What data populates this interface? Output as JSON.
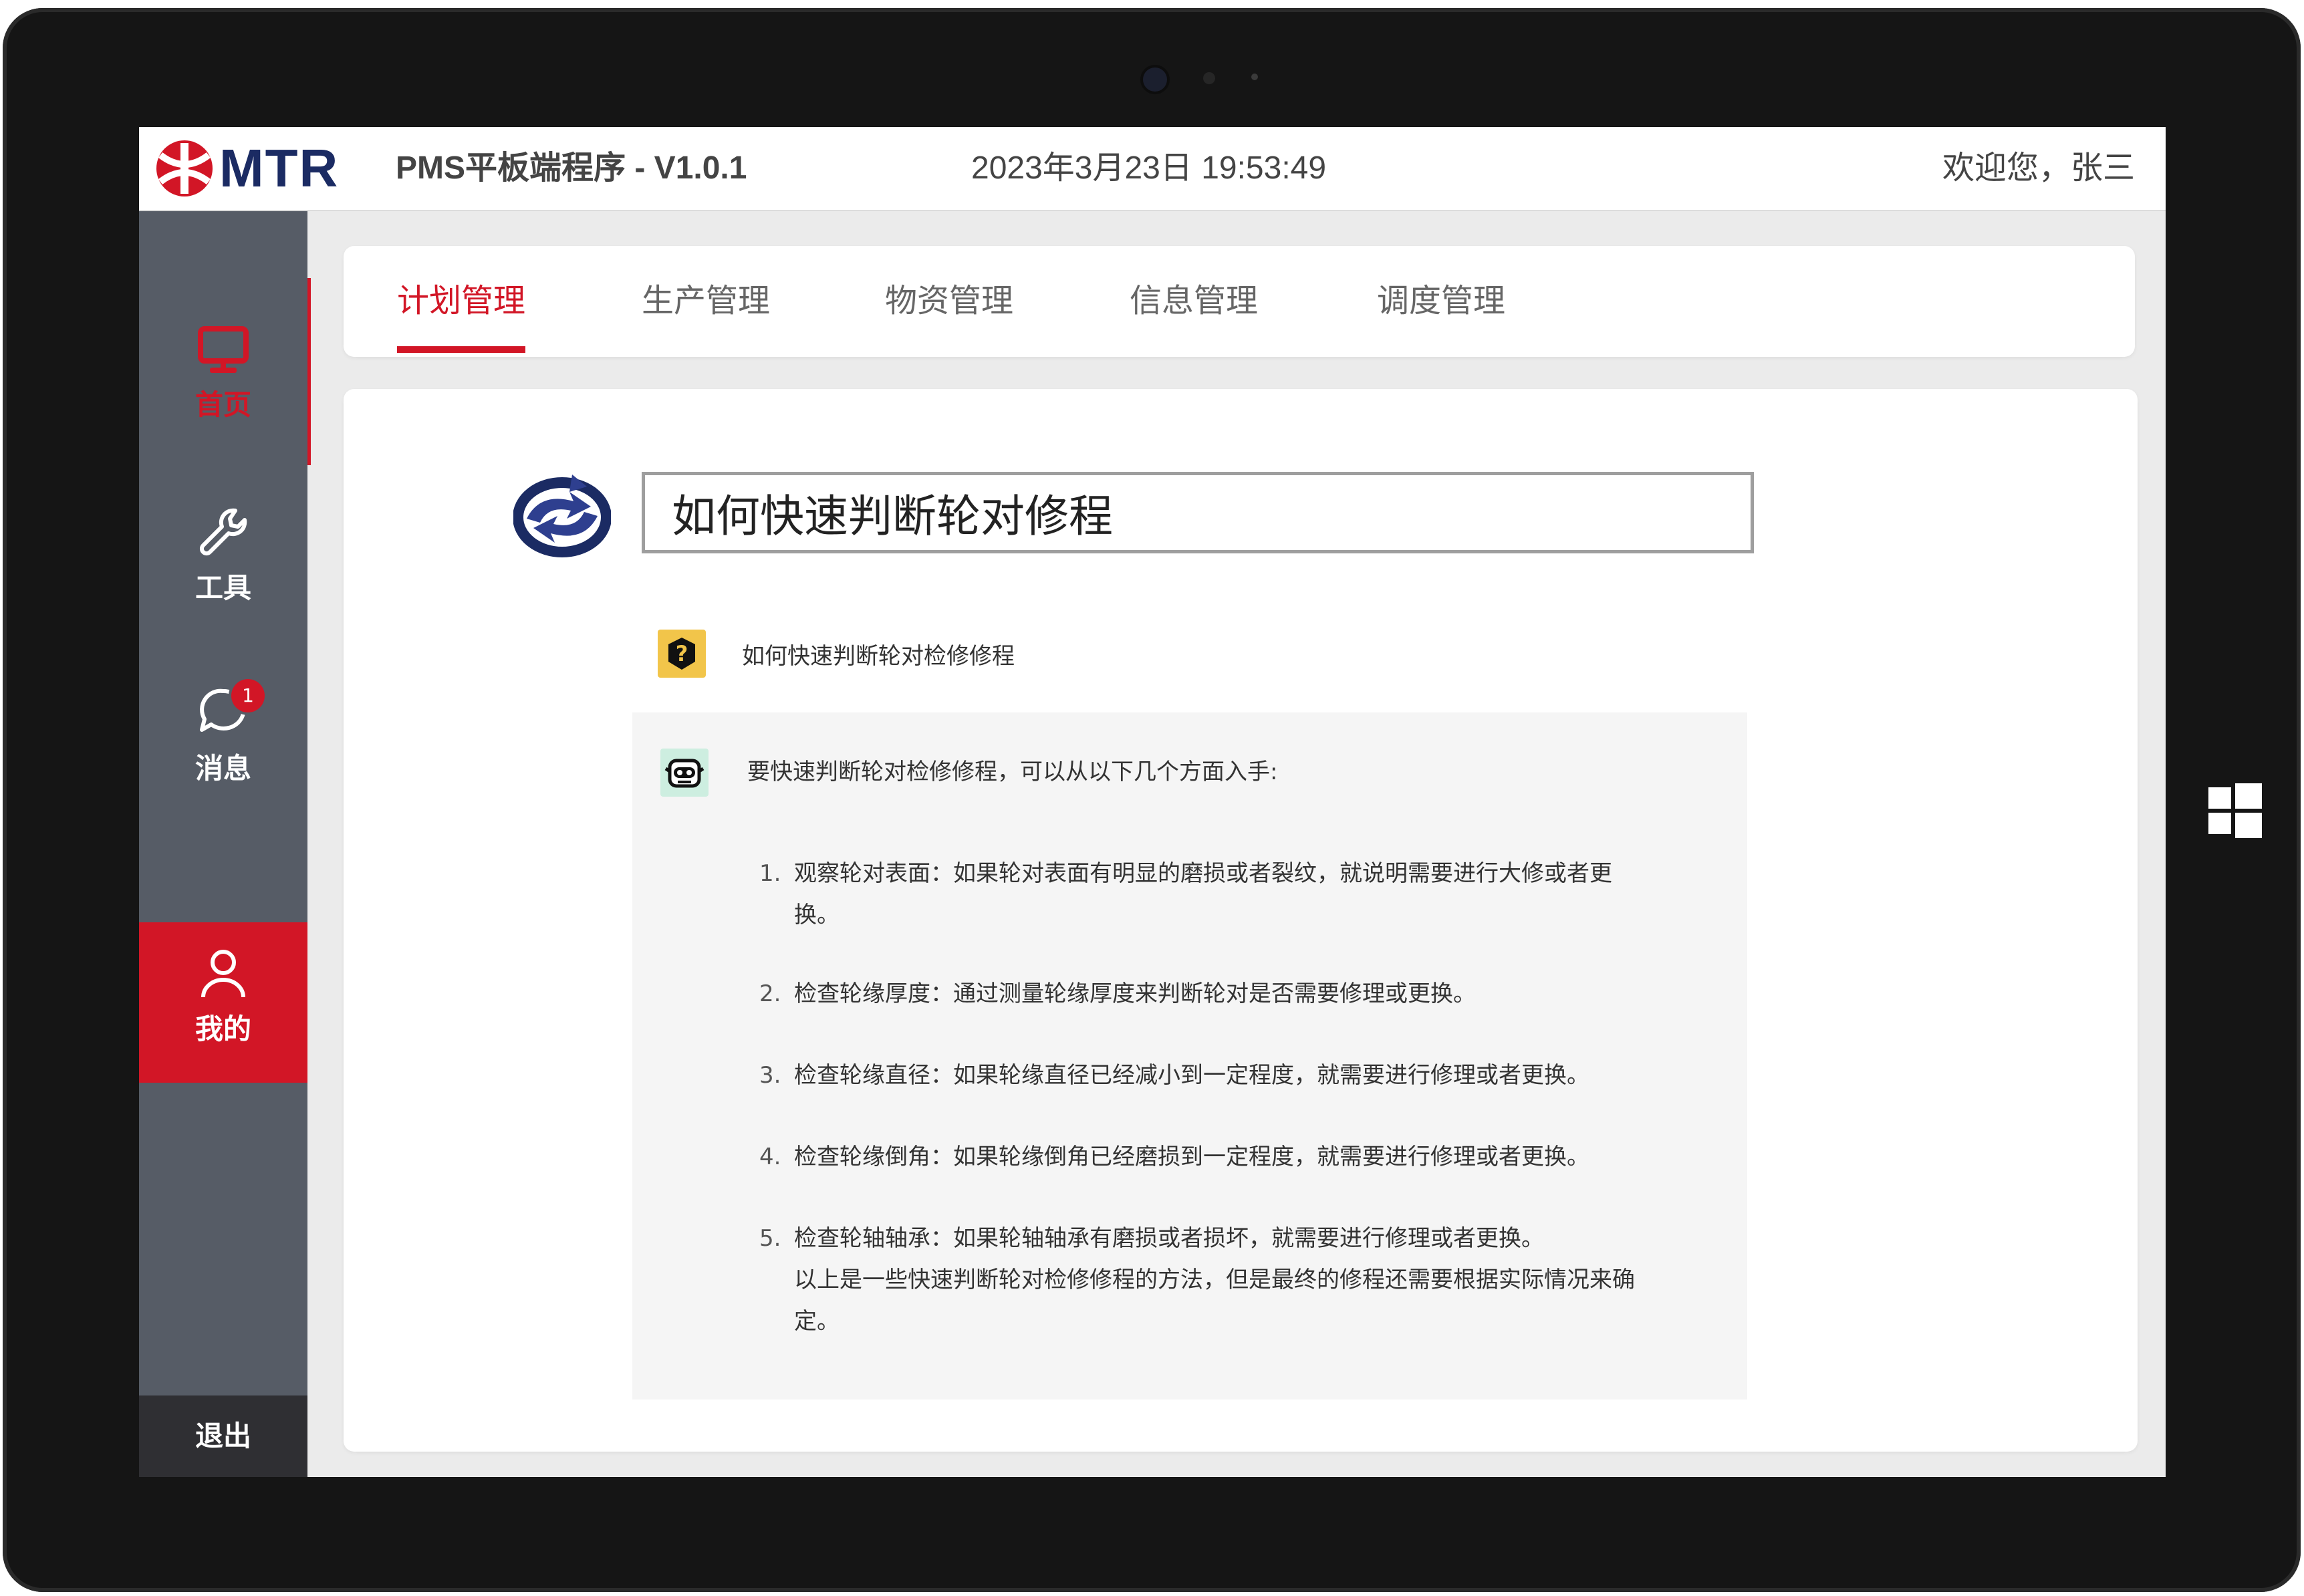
{
  "header": {
    "logo_text": "MTR",
    "app_title": "PMS平板端程序 - V1.0.1",
    "datetime": "2023年3月23日 19:53:49",
    "welcome": "欢迎您，张三",
    "colors": {
      "brand_red": "#d21626",
      "brand_navy": "#1b2b63"
    }
  },
  "sidebar": {
    "items": [
      {
        "label": "首页",
        "icon": "monitor-icon",
        "state": "selected"
      },
      {
        "label": "工具",
        "icon": "wrench-icon"
      },
      {
        "label": "消息",
        "icon": "chat-bubble-icon",
        "badge": "1"
      },
      {
        "label": "我的",
        "icon": "user-icon",
        "state": "highlighted"
      }
    ],
    "logout_label": "退出"
  },
  "tabs": [
    {
      "label": "计划管理",
      "active": true
    },
    {
      "label": "生产管理"
    },
    {
      "label": "物资管理"
    },
    {
      "label": "信息管理"
    },
    {
      "label": "调度管理"
    }
  ],
  "chat": {
    "input_value": "如何快速判断轮对修程",
    "question": "如何快速判断轮对检修修程",
    "answer_intro": "要快速判断轮对检修修程，可以从以下几个方面入手:",
    "answer_items": [
      {
        "num": "1.",
        "text": "观察轮对表面：如果轮对表面有明显的磨损或者裂纹，就说明需要进行大修或者更换。"
      },
      {
        "num": "2.",
        "text": "检查轮缘厚度：通过测量轮缘厚度来判断轮对是否需要修理或更换。"
      },
      {
        "num": "3.",
        "text": "检查轮缘直径：如果轮缘直径已经减小到一定程度，就需要进行修理或者更换。"
      },
      {
        "num": "4.",
        "text": "检查轮缘倒角：如果轮缘倒角已经磨损到一定程度，就需要进行修理或者更换。"
      },
      {
        "num": "5.",
        "text": "检查轮轴轴承：如果轮轴轴承有磨损或者损坏，就需要进行修理或者更换。"
      }
    ],
    "answer_conclusion": "以上是一些快速判断轮对检修修程的方法，但是最终的修程还需要根据实际情况来确定。"
  }
}
